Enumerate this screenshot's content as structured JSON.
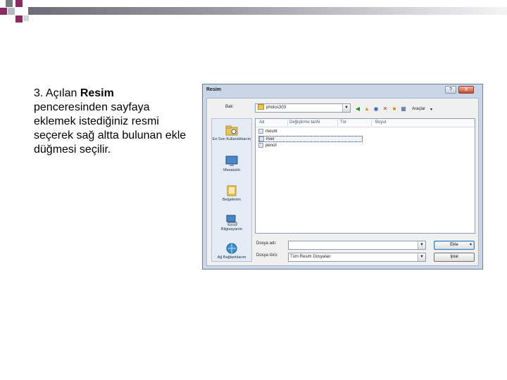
{
  "slide": {
    "caption_prefix": "3. Açılan ",
    "caption_bold": "Resim",
    "caption_rest": " penceresinden sayfaya eklemek istediğiniz resmi seçerek sağ altta bulunan ekle düğmesi seçilir."
  },
  "dialog": {
    "title": "Resim",
    "help_label": "?",
    "close_label": "X",
    "look_in_label": "Bak:",
    "look_in_value": "photos303",
    "toolbar_icons": [
      "back-icon",
      "up-folder-icon",
      "search-web-icon",
      "delete-icon",
      "new-folder-icon",
      "views-icon"
    ],
    "views_label": "Araçlar",
    "places": [
      {
        "icon": "recent-folder-icon",
        "label": "En Son Kullandıklarım"
      },
      {
        "icon": "desktop-icon",
        "label": "Masaüstü"
      },
      {
        "icon": "my-documents-icon",
        "label": "Belgelerim"
      },
      {
        "icon": "my-computer-icon",
        "label": "Bilgisayarım"
      },
      {
        "icon": "network-places-icon",
        "label": "Ağ Bağlantılarım"
      }
    ],
    "columns": [
      "Ad",
      "Değiştirme tarihi",
      "Tür",
      "Boyut"
    ],
    "files": [
      {
        "name": "mount",
        "selected": false
      },
      {
        "name": "river",
        "selected": true
      },
      {
        "name": "pencil",
        "selected": false
      }
    ],
    "file_name_label": "Dosya adı:",
    "file_name_value": "",
    "file_type_label": "Dosya türü:",
    "file_type_value": "Tüm Resim Dosyaları",
    "insert_button": "Ekle",
    "cancel_button": "İptal"
  }
}
